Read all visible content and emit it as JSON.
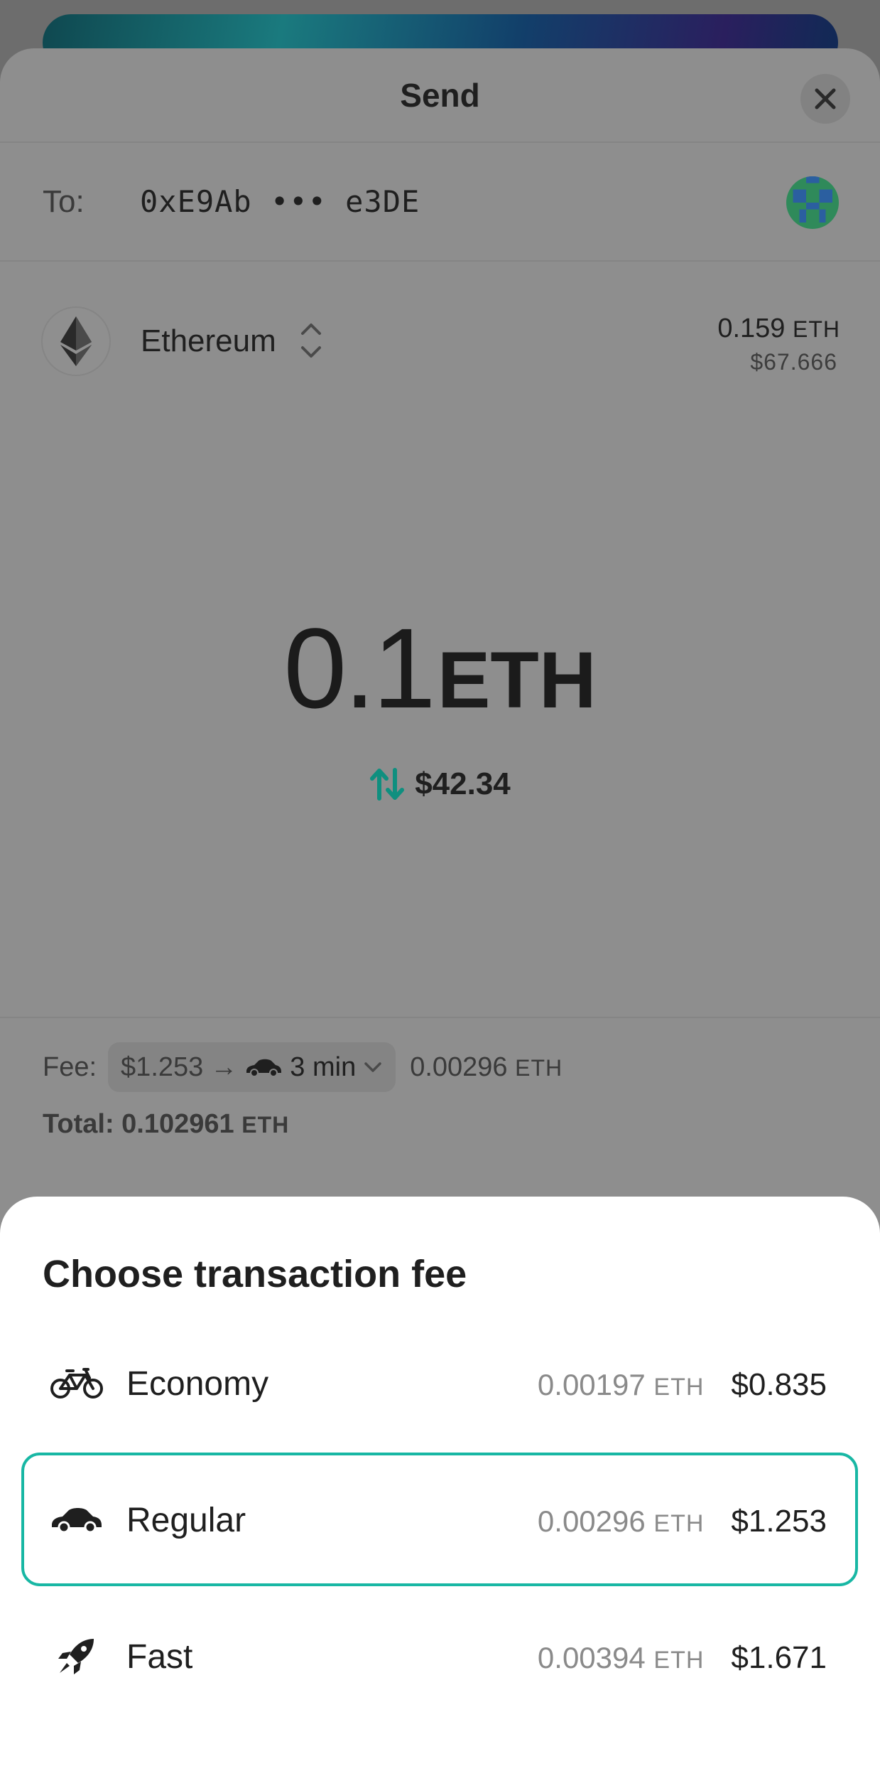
{
  "send": {
    "title": "Send",
    "to_label": "To:",
    "to_address": "0xE9Ab ••• e3DE",
    "asset": {
      "name": "Ethereum",
      "balance": "0.159",
      "balance_unit": "ETH",
      "balance_usd": "$67.666"
    },
    "amount": {
      "value": "0.1",
      "unit": "ETH",
      "fiat": "$42.34"
    },
    "fee": {
      "label": "Fee:",
      "fiat": "$1.253",
      "arrow": "→",
      "time": "3 min",
      "eth": "0.00296",
      "eth_unit": "ETH"
    },
    "total": {
      "label": "Total: 0.102961",
      "unit": "ETH"
    }
  },
  "fee_sheet": {
    "title": "Choose transaction fee",
    "options": [
      {
        "name": "Economy",
        "icon": "bicycle-icon",
        "eth": "0.00197",
        "unit": "ETH",
        "usd": "$0.835",
        "selected": false
      },
      {
        "name": "Regular",
        "icon": "car-icon",
        "eth": "0.00296",
        "unit": "ETH",
        "usd": "$1.253",
        "selected": true
      },
      {
        "name": "Fast",
        "icon": "rocket-icon",
        "eth": "0.00394",
        "unit": "ETH",
        "usd": "$1.671",
        "selected": false
      }
    ]
  },
  "colors": {
    "accent": "#18b7a4",
    "overlay": "#8e8e8e",
    "text": "#1f1f1f"
  }
}
